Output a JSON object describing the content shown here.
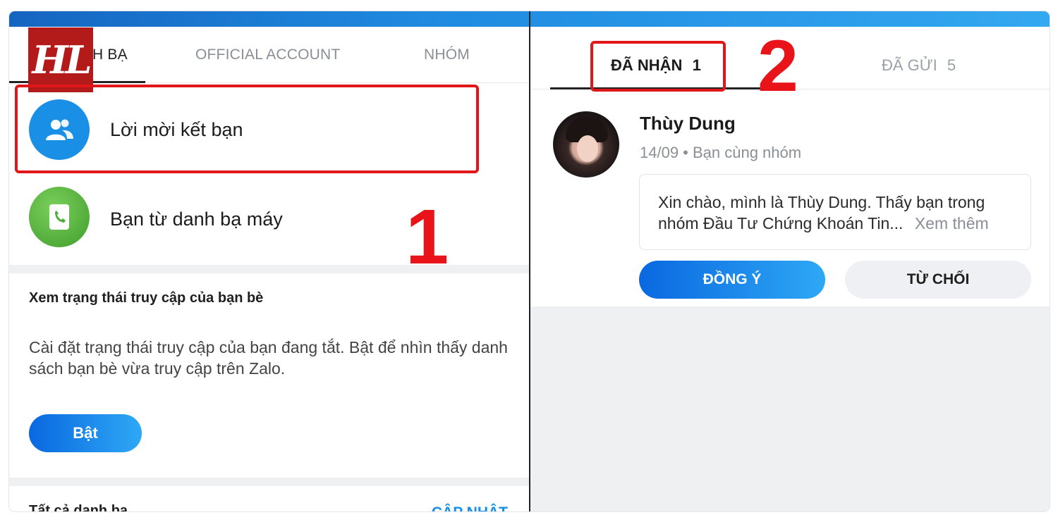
{
  "left_panel": {
    "logo_text": "HL",
    "tabs": [
      {
        "label": "H BẠ"
      },
      {
        "label": "OFFICIAL ACCOUNT"
      },
      {
        "label": "NHÓM"
      }
    ],
    "rows": [
      {
        "label": "Lời mời kết bạn",
        "icon": "users-icon",
        "color": "#1a8fe6"
      },
      {
        "label": "Bạn từ danh bạ máy",
        "icon": "phone-icon",
        "color": "#4cae3c"
      }
    ],
    "annotation_number": "1",
    "status_section": {
      "title": "Xem trạng thái truy cập của bạn bè",
      "description": "Cài đặt trạng thái truy cập của bạn đang tắt. Bật để nhìn thấy danh sách bạn bè vừa truy cập trên Zalo.",
      "button_label": "Bật"
    },
    "contacts_section": {
      "title": "Tất cả danh bạ",
      "update_label": "CẬP NHẬT"
    }
  },
  "right_panel": {
    "tabs": [
      {
        "label": "ĐÃ NHẬN",
        "count": "1"
      },
      {
        "label": "ĐÃ GỬI",
        "count": "5"
      }
    ],
    "annotation_number": "2",
    "request": {
      "name": "Thùy Dung",
      "meta": "14/09 • Bạn cùng nhóm",
      "message_line1": "Xin chào, mình là Thùy Dung. Thấy bạn trong",
      "message_line2": "nhóm Đầu Tư Chứng Khoán Tin...",
      "more_label": "Xem thêm",
      "accept_label": "ĐỒNG Ý",
      "decline_label": "TỪ CHỐI"
    }
  },
  "colors": {
    "accent_blue": "#1a8fe6",
    "annotation_red": "#e0161b",
    "brand_red": "#b31a1a"
  }
}
